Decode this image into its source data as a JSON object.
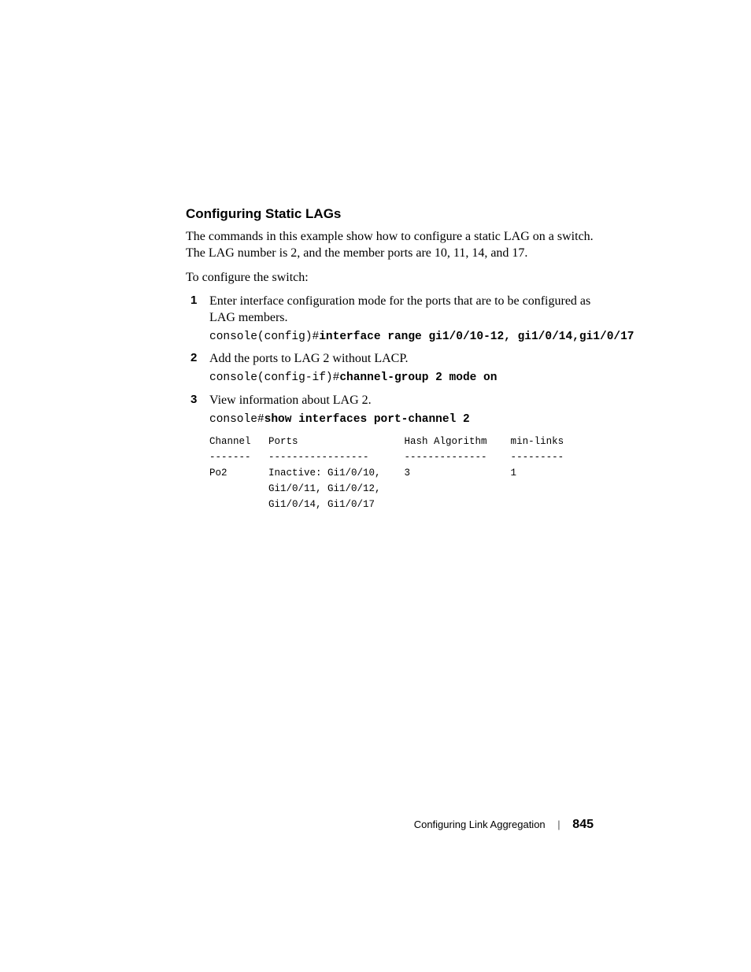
{
  "heading": "Configuring Static LAGs",
  "intro": "The commands in this example show how to configure a static LAG on a switch. The LAG number is 2, and the member ports are 10, 11, 14, and 17.",
  "lead": "To configure the switch:",
  "steps": [
    {
      "num": "1",
      "text": "Enter interface configuration mode for the ports that are to be configured as LAG members.",
      "code_plain": "console(config)#",
      "code_bold": "interface range gi1/0/10-12, gi1/0/14,gi1/0/17"
    },
    {
      "num": "2",
      "text": "Add the ports to LAG 2 without LACP.",
      "code_plain": "console(config-if)#",
      "code_bold": "channel-group 2 mode on"
    },
    {
      "num": "3",
      "text": "View information about LAG 2.",
      "code_plain": "console#",
      "code_bold": "show interfaces port-channel 2"
    }
  ],
  "cli_output": {
    "header": "Channel   Ports                  Hash Algorithm    min-links",
    "divider": "-------   -----------------      --------------    ---------",
    "row1": "Po2       Inactive: Gi1/0/10,    3                 1",
    "row2": "          Gi1/0/11, Gi1/0/12,",
    "row3": "          Gi1/0/14, Gi1/0/17"
  },
  "footer": {
    "title": "Configuring Link Aggregation",
    "page": "845"
  }
}
